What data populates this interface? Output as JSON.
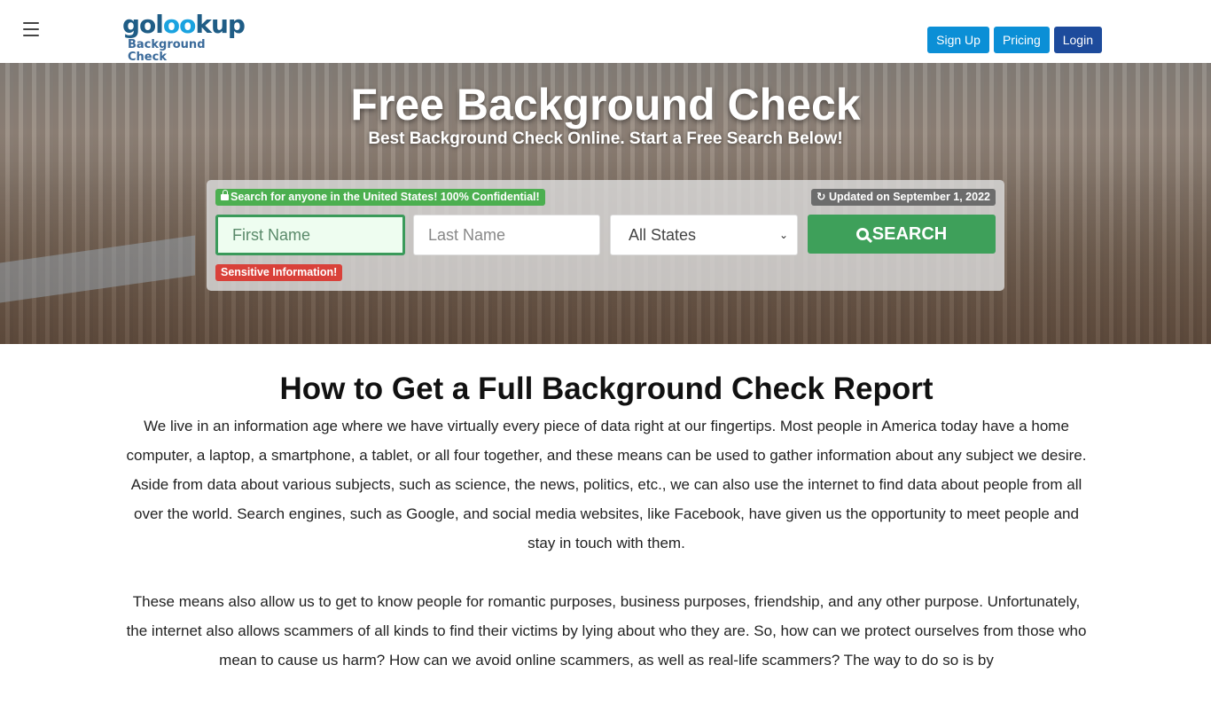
{
  "header": {
    "logo_main_a": "gol",
    "logo_main_oo": "oo",
    "logo_main_b": "kup",
    "logo_sub": "Background Check",
    "buttons": [
      {
        "label": "Sign Up"
      },
      {
        "label": "Pricing"
      },
      {
        "label": "Login"
      }
    ]
  },
  "hero": {
    "title": "Free Background Check",
    "subtitle": "Best Background Check Online. Start a Free Search Below!"
  },
  "search": {
    "confidential_badge": "Search for anyone in the United States! 100% Confidential!",
    "updated_badge": "Updated on September 1, 2022",
    "first_name_placeholder": "First Name",
    "last_name_placeholder": "Last Name",
    "state_selected": "All States",
    "search_label": "SEARCH",
    "sensitive_badge": "Sensitive Information!"
  },
  "article": {
    "heading": "How to Get a Full Background Check Report",
    "paragraphs": [
      "We live in an information age where we have virtually every piece of data right at our fingertips. Most people in America today have a home computer, a laptop, a smartphone, a tablet, or all four together, and these means can be used to gather information about any subject we desire. Aside from data about various subjects, such as science, the news, politics, etc., we can also use the internet to find data about people from all over the world. Search engines, such as Google, and social media websites, like Facebook, have given us the opportunity to meet people and stay in touch with them.",
      "These means also allow us to get to know people for romantic purposes, business purposes, friendship, and any other purpose. Unfortunately, the internet also allows scammers of all kinds to find their victims by lying about who they are. So, how can we protect ourselves from those who mean to cause us harm? How can we avoid online scammers, as well as real-life scammers? The way to do so is by"
    ]
  }
}
